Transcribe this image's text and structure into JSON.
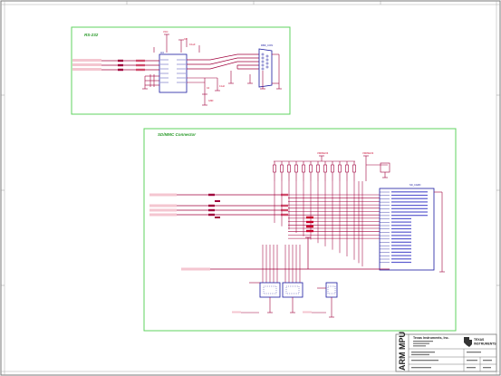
{
  "sections": {
    "rs232_title": "RS-232",
    "sdmmc_title": "SD/MMC Connector"
  },
  "rs232": {
    "ic_label": "U3",
    "connector_label": "DB9_CON"
  },
  "sdmmc": {
    "connector_label": "SD_CARD",
    "vdd_label": "VDDSHV4",
    "vdd2_label": "VDDSHV4"
  },
  "title_block": {
    "vertical_text": "ARM MPU",
    "company": "Texas Instruments, Inc.",
    "logo_line1": "TEXAS",
    "logo_line2": "INSTRUMENTS"
  },
  "colors": {
    "section_border": "#5fd35f",
    "wire": "#a0003c",
    "component": "#1a1aa0",
    "net_label": "#c8002a",
    "frame": "#777777"
  }
}
